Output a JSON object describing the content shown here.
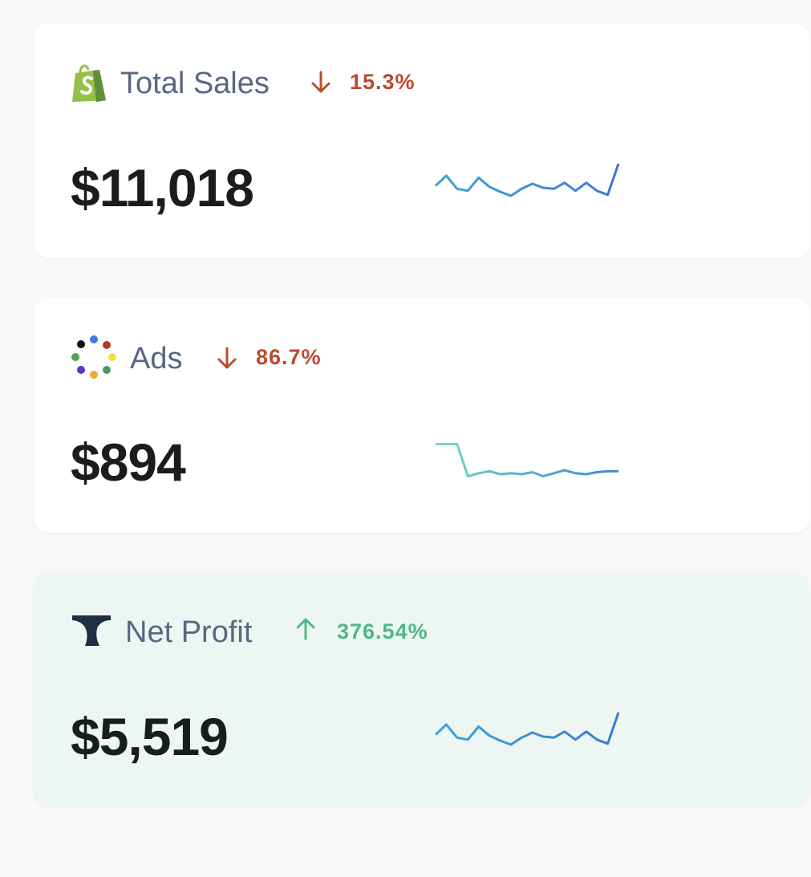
{
  "cards": [
    {
      "title": "Total Sales",
      "icon": "shopify-bag-icon",
      "trend_direction": "down",
      "trend_value": "15.3%",
      "amount": "$11,018",
      "sparkline": [
        38,
        48,
        35,
        33,
        46,
        37,
        32,
        28,
        35,
        40,
        36,
        35,
        41,
        33,
        41,
        33,
        29,
        60
      ],
      "sparkline_colors": [
        "#3fa5d6",
        "#3b78d4"
      ]
    },
    {
      "title": "Ads",
      "icon": "dot-ring-icon",
      "trend_direction": "down",
      "trend_value": "86.7%",
      "amount": "$894",
      "sparkline": [
        46,
        46,
        46,
        14,
        17,
        19,
        16,
        17,
        16,
        18,
        14,
        17,
        20,
        17,
        16,
        18,
        19,
        19
      ],
      "sparkline_colors": [
        "#6fdcbc",
        "#3f87d4"
      ]
    },
    {
      "title": "Net Profit",
      "icon": "whale-tail-logo-icon",
      "trend_direction": "up",
      "trend_value": "376.54%",
      "amount": "$5,519",
      "sparkline": [
        38,
        48,
        35,
        33,
        46,
        37,
        32,
        28,
        35,
        40,
        36,
        35,
        41,
        33,
        41,
        33,
        29,
        60
      ],
      "sparkline_colors": [
        "#3fa5d6",
        "#3b78d4"
      ]
    }
  ],
  "colors": {
    "trend_down": "#bd4a2e",
    "trend_up": "#4eb887",
    "highlight_card_bg": "#edf6f2"
  }
}
